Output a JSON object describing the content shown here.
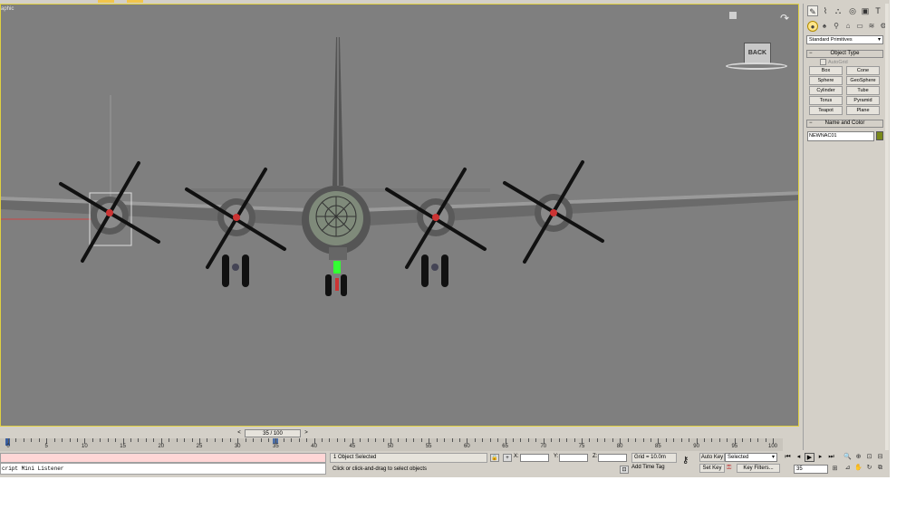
{
  "viewport": {
    "label": "aphic",
    "viewcube_face": "BACK",
    "colors": {
      "background": "#7f7f7f",
      "border": "#e0d040"
    }
  },
  "time_slider": {
    "prev": "<",
    "value": "35 / 100",
    "next": ">"
  },
  "timeline": {
    "labels": [
      "0",
      "5",
      "10",
      "15",
      "20",
      "25",
      "30",
      "35",
      "40",
      "45",
      "50",
      "55",
      "60",
      "65",
      "70",
      "75",
      "80",
      "85",
      "90",
      "95",
      "100"
    ],
    "current_frame": 35,
    "total_frames": 100
  },
  "maxscript": {
    "listener_top": "",
    "listener_bottom": "cript Mini Listener"
  },
  "status": {
    "selection": "1 Object Selected",
    "prompt": "Click or click-and-drag to select objects",
    "x_label": "X:",
    "y_label": "Y:",
    "z_label": "Z:",
    "x_value": "",
    "y_value": "",
    "z_value": "",
    "grid": "Grid = 10.0m",
    "add_time_tag": "Add Time Tag"
  },
  "animation": {
    "auto_key": "Auto Key",
    "set_key": "Set Key",
    "selected": "Selected",
    "key_filters": "Key Filters...",
    "frame": "35"
  },
  "command_panel": {
    "primitive_type": "Standard Primitives",
    "object_type_title": "Object Type",
    "autogrid": "AutoGrid",
    "buttons": [
      {
        "label": "Box"
      },
      {
        "label": "Cone"
      },
      {
        "label": "Sphere"
      },
      {
        "label": "GeoSphere"
      },
      {
        "label": "Cylinder"
      },
      {
        "label": "Tube"
      },
      {
        "label": "Torus"
      },
      {
        "label": "Pyramid"
      },
      {
        "label": "Teapot"
      },
      {
        "label": "Plane"
      }
    ],
    "name_color_title": "Name and Color",
    "object_name": "NEWNAC01",
    "object_color": "#7a8a1a"
  },
  "icons": {
    "tabs": [
      "create-icon",
      "modify-icon",
      "hierarchy-icon",
      "motion-icon",
      "display-icon",
      "utilities-icon"
    ],
    "categories": [
      "geometry-icon",
      "shapes-icon",
      "lights-icon",
      "cameras-icon",
      "helpers-icon",
      "spacewarps-icon",
      "systems-icon"
    ]
  }
}
